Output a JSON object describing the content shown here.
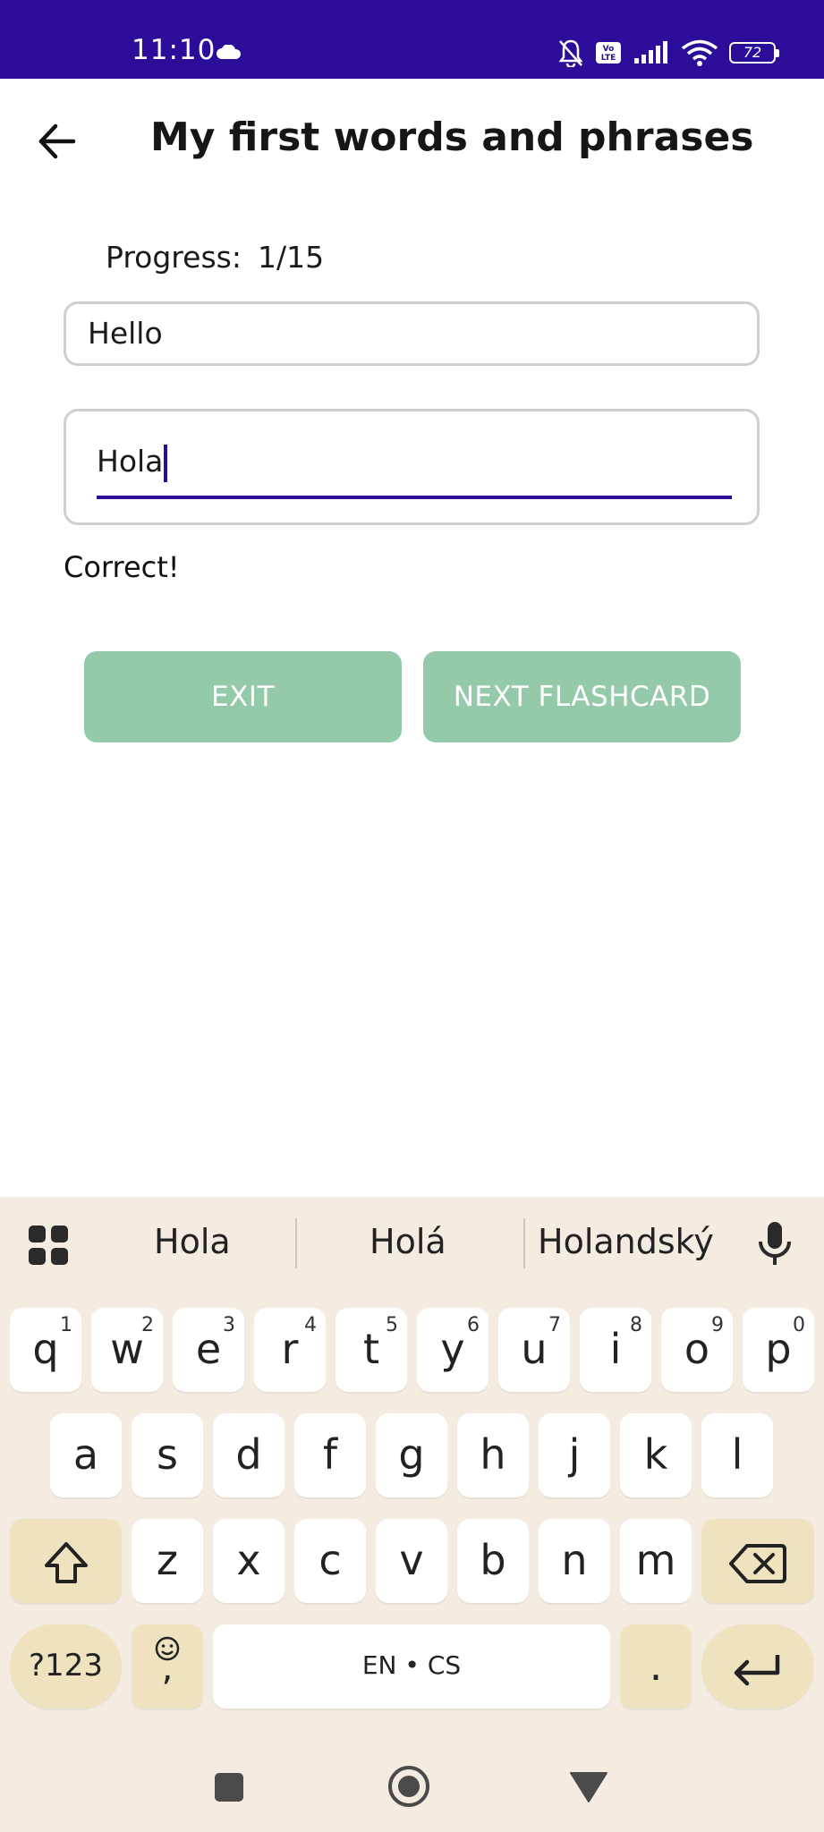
{
  "status_bar": {
    "time": "11:10",
    "battery": "72",
    "icons": [
      "cloud-icon",
      "bell-muted-icon",
      "volte-icon",
      "signal-icon",
      "wifi-icon",
      "battery-icon"
    ]
  },
  "app_bar": {
    "title": "My first words and phrases",
    "back_icon": "arrow-left-icon"
  },
  "progress": {
    "label": "Progress:",
    "value": "1/15"
  },
  "prompt_field": {
    "value": "Hello"
  },
  "answer_field": {
    "value": "Hola"
  },
  "feedback": "Correct!",
  "buttons": {
    "exit": "EXIT",
    "next": "NEXT FLASHCARD"
  },
  "colors": {
    "status_bar": "#2b0d9a",
    "accent": "#2b0d9a",
    "button": "#94c9aa",
    "keyboard_bg": "#f4ece0",
    "key_dark": "#efe2bf"
  },
  "keyboard": {
    "suggestions": [
      "Hola",
      "Holá",
      "Holandský"
    ],
    "row1": [
      {
        "key": "q",
        "num": "1"
      },
      {
        "key": "w",
        "num": "2"
      },
      {
        "key": "e",
        "num": "3"
      },
      {
        "key": "r",
        "num": "4"
      },
      {
        "key": "t",
        "num": "5"
      },
      {
        "key": "y",
        "num": "6"
      },
      {
        "key": "u",
        "num": "7"
      },
      {
        "key": "i",
        "num": "8"
      },
      {
        "key": "o",
        "num": "9"
      },
      {
        "key": "p",
        "num": "0"
      }
    ],
    "row2": [
      "a",
      "s",
      "d",
      "f",
      "g",
      "h",
      "j",
      "k",
      "l"
    ],
    "row3": [
      "z",
      "x",
      "c",
      "v",
      "b",
      "n",
      "m"
    ],
    "symbols_key": "?123",
    "emoji_comma": ",",
    "space_label": "EN • CS",
    "period": "."
  }
}
